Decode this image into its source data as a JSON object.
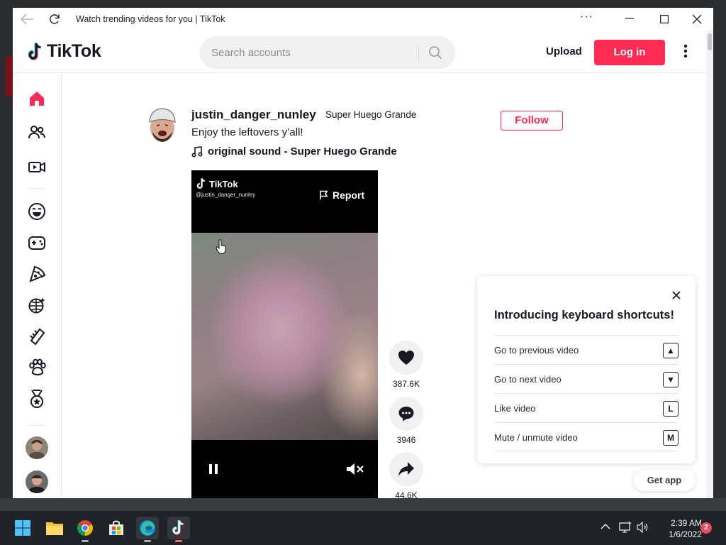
{
  "window": {
    "title": "Watch trending videos for you | TikTok",
    "more_label": "···"
  },
  "header": {
    "logo_text": "TikTok",
    "search_placeholder": "Search accounts",
    "search_value": "",
    "upload_label": "Upload",
    "login_label": "Log in"
  },
  "sidebar": {
    "items": [
      {
        "icon": "home-icon",
        "label": "For You",
        "active": true
      },
      {
        "icon": "following-icon",
        "label": "Following"
      },
      {
        "icon": "live-icon",
        "label": "LIVE"
      },
      {
        "icon": "comedy-icon",
        "label": "Comedy"
      },
      {
        "icon": "gaming-icon",
        "label": "Gaming"
      },
      {
        "icon": "food-icon",
        "label": "Food"
      },
      {
        "icon": "dance-icon",
        "label": "Dance"
      },
      {
        "icon": "beauty-icon",
        "label": "Beauty"
      },
      {
        "icon": "animals-icon",
        "label": "Animals"
      },
      {
        "icon": "sports-icon",
        "label": "Sports"
      }
    ]
  },
  "post": {
    "username": "justin_danger_nunley",
    "nickname": "Super Huego Grande",
    "caption": "Enjoy the leftovers y’all!",
    "music": "original sound - Super Huego Grande",
    "follow_label": "Follow",
    "video": {
      "watermark": "TikTok",
      "watermark_user": "@justin_danger_nunley",
      "report_label": "Report"
    },
    "likes": "387.6K",
    "comments": "3946",
    "shares": "44.6K"
  },
  "shortcuts_popup": {
    "title": "Introducing keyboard shortcuts!",
    "rows": [
      {
        "label": "Go to previous video",
        "key": "▲"
      },
      {
        "label": "Go to next video",
        "key": "▼"
      },
      {
        "label": "Like video",
        "key": "L"
      },
      {
        "label": "Mute / unmute video",
        "key": "M"
      }
    ]
  },
  "get_app_label": "Get app",
  "taskbar": {
    "time": "2:39 AM",
    "date": "1/6/2022",
    "notification_count": "2"
  },
  "colors": {
    "brand": "#fe2c55",
    "text": "#161823"
  }
}
